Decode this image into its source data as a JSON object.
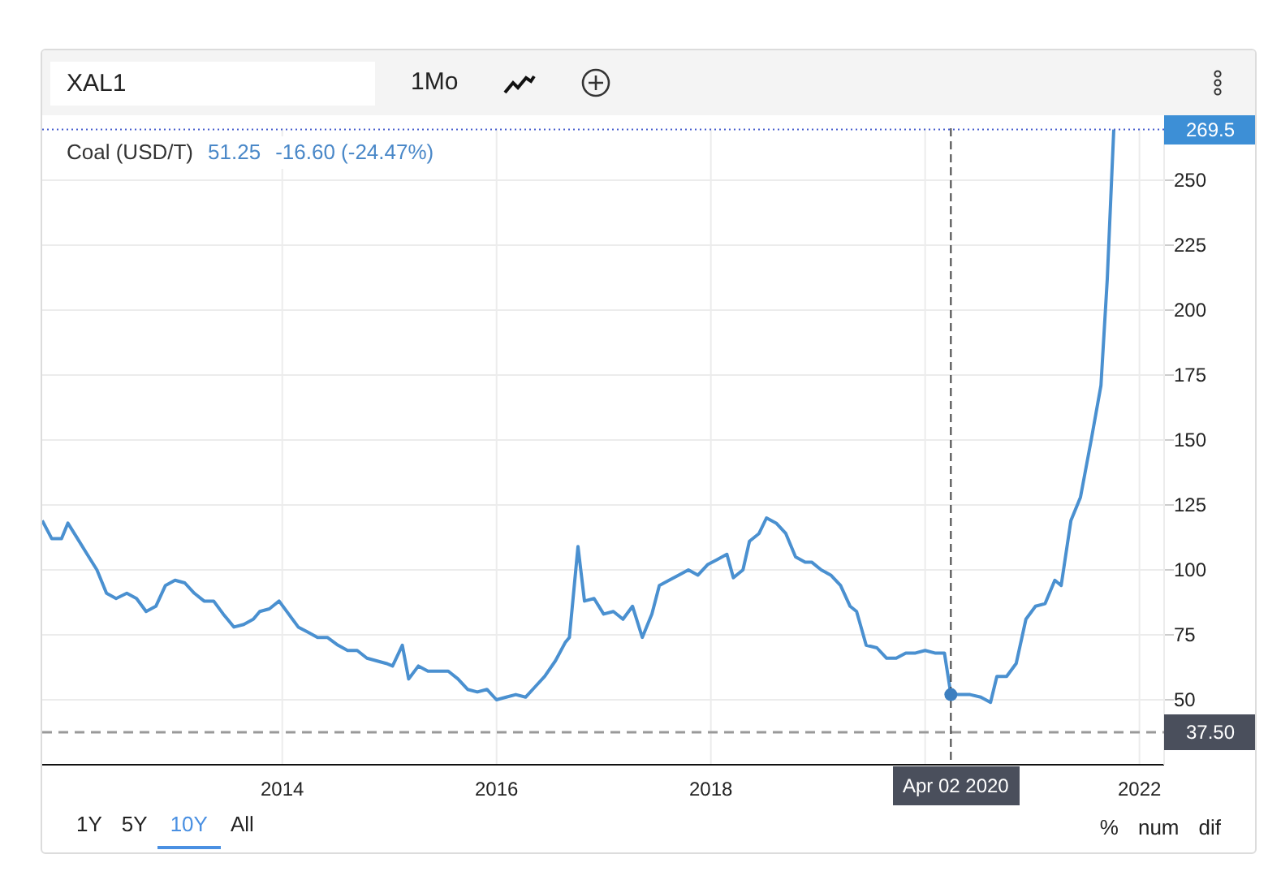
{
  "toolbar": {
    "symbol": {
      "value": "XAL1"
    },
    "interval": "1Mo"
  },
  "legend": {
    "price": "51.25",
    "change": "-16.60 (-24.47%)"
  },
  "chart_data": {
    "type": "line",
    "grid": true,
    "xlim": [
      2011.76,
      2022.23
    ],
    "ylim": [
      25,
      270
    ],
    "xticks": [
      2014,
      2016,
      2018,
      2022
    ],
    "yticks": [
      50,
      75,
      100,
      125,
      150,
      175,
      200,
      225,
      250
    ],
    "x": [
      2011.76,
      2011.85,
      2011.94,
      2012.0,
      2012.09,
      2012.18,
      2012.27,
      2012.36,
      2012.45,
      2012.55,
      2012.64,
      2012.73,
      2012.82,
      2012.91,
      2013.0,
      2013.09,
      2013.18,
      2013.27,
      2013.36,
      2013.45,
      2013.55,
      2013.64,
      2013.73,
      2013.79,
      2013.88,
      2013.97,
      2014.06,
      2014.15,
      2014.24,
      2014.33,
      2014.42,
      2014.52,
      2014.61,
      2014.7,
      2014.79,
      2014.88,
      2014.97,
      2015.03,
      2015.12,
      2015.18,
      2015.27,
      2015.36,
      2015.45,
      2015.55,
      2015.64,
      2015.73,
      2015.82,
      2015.91,
      2016.0,
      2016.09,
      2016.18,
      2016.27,
      2016.36,
      2016.45,
      2016.55,
      2016.64,
      2016.68,
      2016.76,
      2016.82,
      2016.91,
      2017.0,
      2017.09,
      2017.18,
      2017.27,
      2017.36,
      2017.45,
      2017.52,
      2017.61,
      2017.7,
      2017.79,
      2017.88,
      2017.97,
      2018.06,
      2018.15,
      2018.21,
      2018.3,
      2018.36,
      2018.45,
      2018.52,
      2018.61,
      2018.7,
      2018.79,
      2018.88,
      2018.94,
      2019.03,
      2019.12,
      2019.21,
      2019.3,
      2019.36,
      2019.45,
      2019.55,
      2019.64,
      2019.73,
      2019.82,
      2019.91,
      2020.0,
      2020.09,
      2020.18,
      2020.24,
      2020.33,
      2020.42,
      2020.52,
      2020.61,
      2020.67,
      2020.76,
      2020.85,
      2020.94,
      2021.03,
      2021.12,
      2021.21,
      2021.27,
      2021.36,
      2021.45,
      2021.55,
      2021.64,
      2021.7,
      2021.76
    ],
    "series": [
      {
        "name": "Coal (USD/T)",
        "color": "#4a90d0",
        "values": [
          119,
          112,
          112,
          118,
          112,
          106,
          100,
          91,
          89,
          91,
          89,
          84,
          86,
          94,
          96,
          95,
          91,
          88,
          88,
          83,
          78,
          79,
          81,
          84,
          85,
          88,
          83,
          78,
          76,
          74,
          74,
          71,
          69,
          69,
          66,
          65,
          64,
          63,
          71,
          58,
          63,
          61,
          61,
          61,
          58,
          54,
          53,
          54,
          50,
          51,
          52,
          51,
          55,
          59,
          65,
          72,
          74,
          109,
          88,
          89,
          83,
          84,
          81,
          86,
          74,
          83,
          94,
          96,
          98,
          100,
          98,
          102,
          104,
          106,
          97,
          100,
          111,
          114,
          120,
          118,
          114,
          105,
          103,
          103,
          100,
          98,
          94,
          86,
          84,
          71,
          70,
          66,
          66,
          68,
          68,
          69,
          68,
          68,
          52,
          52,
          52,
          51,
          49,
          59,
          59,
          64,
          81,
          86,
          87,
          96,
          94,
          119,
          128,
          150,
          171,
          212,
          269.5
        ]
      }
    ],
    "ref_lines": [
      {
        "axis": "y",
        "value": 269.5,
        "label": "269.5"
      },
      {
        "axis": "y",
        "value": 37.5,
        "label": "37.50"
      },
      {
        "axis": "x",
        "value": 2020.24,
        "label": "Apr 02 2020"
      }
    ]
  },
  "ranges": [
    {
      "label": "1Y",
      "selected": false
    },
    {
      "label": "5Y",
      "selected": false
    },
    {
      "label": "10Y",
      "selected": true
    },
    {
      "label": "All",
      "selected": false
    }
  ],
  "modes": [
    "%",
    "num",
    "dif"
  ]
}
